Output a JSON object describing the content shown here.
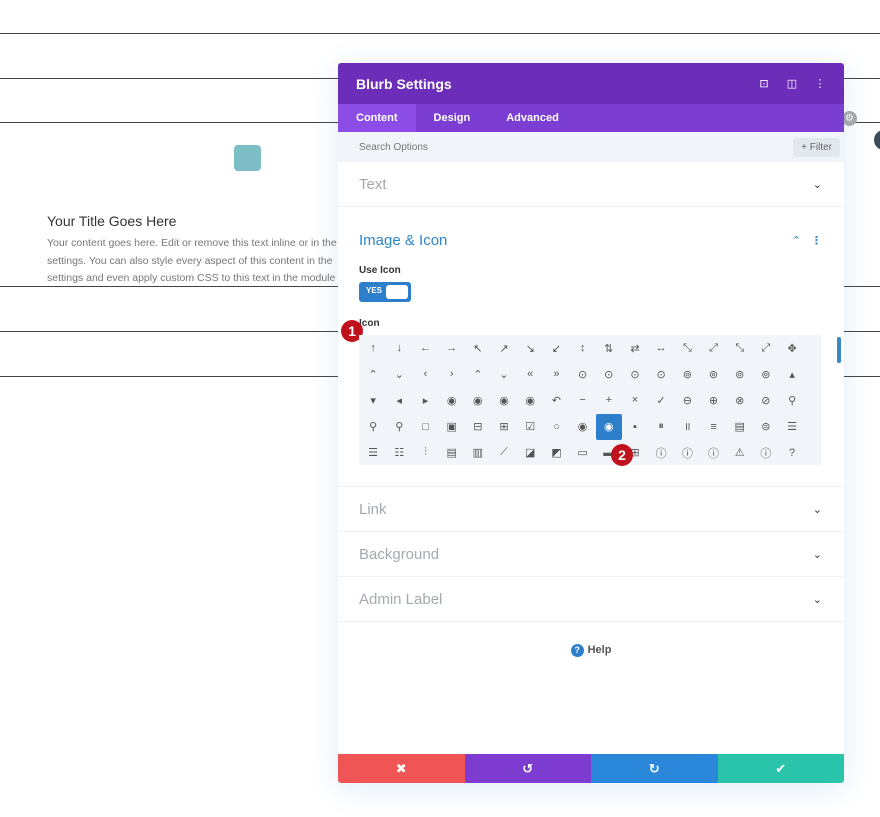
{
  "page": {
    "blurb_title": "Your Title Goes Here",
    "blurb_lines": [
      "Your content goes here. Edit or remove this text inline or in the",
      "settings. You can also style every aspect of this content in the",
      "settings and even apply custom CSS to this text in the module"
    ],
    "accent_color": "#7dbdc6"
  },
  "modal": {
    "title": "Blurb Settings",
    "header_icons": [
      "focus-icon",
      "split-view-icon",
      "more-options-icon"
    ],
    "tabs": [
      {
        "label": "Content",
        "active": true
      },
      {
        "label": "Design",
        "active": false
      },
      {
        "label": "Advanced",
        "active": false
      }
    ],
    "search": {
      "placeholder": "Search Options",
      "value": ""
    },
    "filter_label": "+ Filter",
    "sections": {
      "text": {
        "label": "Text"
      },
      "image_icon": {
        "label": "Image & Icon",
        "use_icon_label": "Use Icon",
        "use_icon_value": "YES",
        "icon_label": "Icon",
        "selected_icon_index": 60
      },
      "link": {
        "label": "Link"
      },
      "background": {
        "label": "Background"
      },
      "admin_label": {
        "label": "Admin Label"
      }
    },
    "icons": [
      "↑",
      "↓",
      "←",
      "→",
      "↖",
      "↗",
      "↘",
      "↙",
      "↕",
      "⇅",
      "⇄",
      "↔",
      "⤡",
      "⤢",
      "⤡",
      "⤢",
      "✥",
      "⌃",
      "⌄",
      "‹",
      "›",
      "⌃",
      "⌄",
      "«",
      "»",
      "⊙",
      "⊙",
      "⊙",
      "⊙",
      "⊚",
      "⊚",
      "⊚",
      "⊚",
      "▴",
      "▾",
      "◂",
      "▸",
      "◉",
      "◉",
      "◉",
      "◉",
      "↶",
      "−",
      "+",
      "×",
      "✓",
      "⊖",
      "⊕",
      "⊗",
      "⊘",
      "⚲",
      "⚲",
      "⚲",
      "□",
      "▣",
      "⊟",
      "⊞",
      "☑",
      "○",
      "◉",
      "◉",
      "▪",
      "⏸",
      "॥",
      "≡",
      "▤",
      "⊜",
      "☰",
      "☰",
      "☷",
      "⫶",
      "▤",
      "▥",
      "⟋",
      "◪",
      "◩",
      "▭",
      "▬",
      "⊞",
      "ⓘ",
      "ⓘ",
      "ⓘ",
      "⚠",
      "ⓘ",
      "?"
    ],
    "badges": {
      "one": "1",
      "two": "2"
    },
    "help_label": "Help",
    "footer": {
      "cancel_icon": "✖",
      "undo_icon": "↺",
      "redo_icon": "↻",
      "save_icon": "✔",
      "colors": {
        "cancel": "#ef5555",
        "undo": "#7e3bd0",
        "redo": "#2b87da",
        "save": "#29c4a9"
      }
    }
  }
}
